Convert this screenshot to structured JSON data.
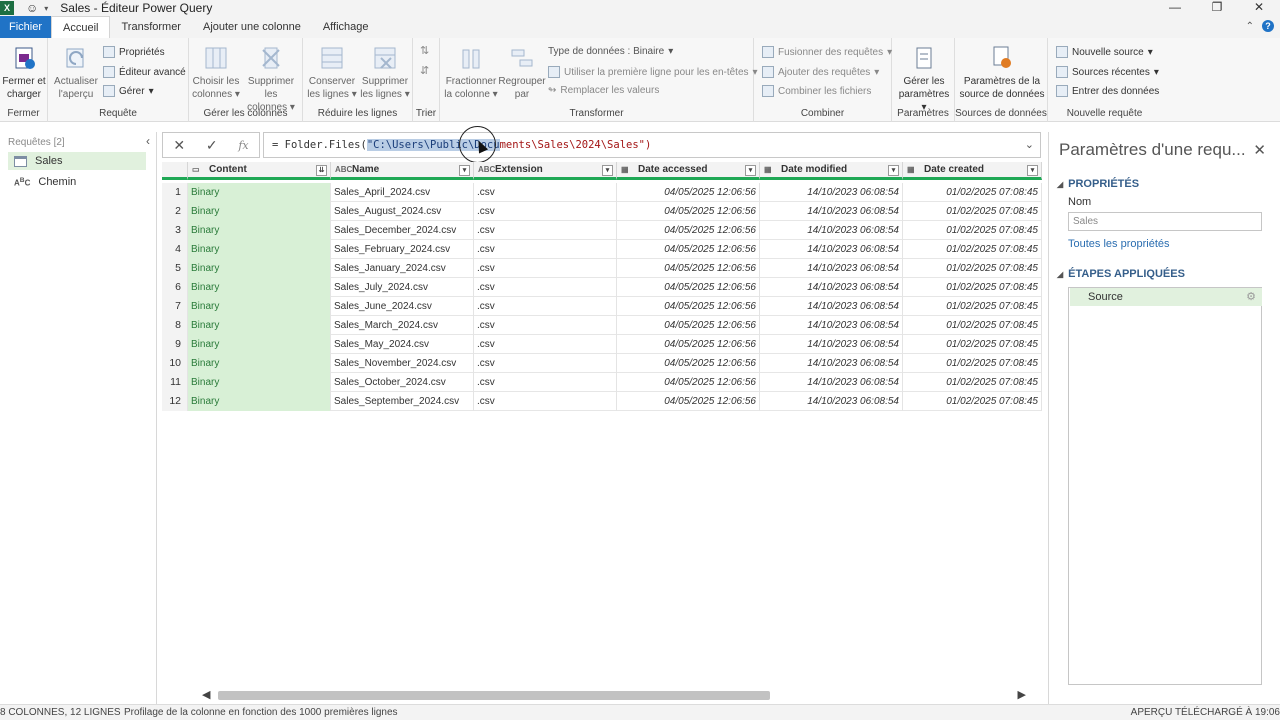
{
  "window": {
    "title": "Sales - Éditeur Power Query",
    "controls": {
      "minimize": "—",
      "restore": "❐",
      "close": "✕"
    }
  },
  "tabs": [
    {
      "label": "Fichier"
    },
    {
      "label": "Accueil"
    },
    {
      "label": "Transformer"
    },
    {
      "label": "Ajouter une colonne"
    },
    {
      "label": "Affichage"
    }
  ],
  "ribbon": {
    "fermer": {
      "btn": "Fermer et",
      "btn2": "charger",
      "group": "Fermer"
    },
    "requete": {
      "actualiser": "Actualiser",
      "actualiser2": "l'aperçu",
      "proprietes": "Propriétés",
      "editeur": "Éditeur avancé",
      "gerer": "Gérer",
      "group": "Requête"
    },
    "colonnes": {
      "choisir": "Choisir les",
      "choisir2": "colonnes",
      "supprimer": "Supprimer les",
      "supprimer2": "colonnes",
      "group": "Gérer les colonnes"
    },
    "lignes": {
      "conserver": "Conserver",
      "conserver2": "les lignes",
      "supprimer": "Supprimer",
      "supprimer2": "les lignes",
      "group": "Réduire les lignes"
    },
    "trier": {
      "group": "Trier"
    },
    "transformer": {
      "fractionner": "Fractionner",
      "fractionner2": "la colonne",
      "regrouper": "Regrouper",
      "regrouper2": "par",
      "type": "Type de données : Binaire",
      "premiere": "Utiliser la première ligne pour les en-têtes",
      "remplacer": "Remplacer les valeurs",
      "group": "Transformer"
    },
    "combiner": {
      "fusionner": "Fusionner des requêtes",
      "ajouter": "Ajouter des requêtes",
      "combiner": "Combiner les fichiers",
      "group": "Combiner"
    },
    "parametres": {
      "gerer": "Gérer les",
      "gerer2": "paramètres",
      "group": "Paramètres"
    },
    "sources": {
      "btn": "Paramètres de la",
      "btn2": "source de données",
      "group": "Sources de données"
    },
    "nouvelle": {
      "source": "Nouvelle source",
      "recentes": "Sources récentes",
      "entrer": "Entrer des données",
      "group": "Nouvelle requête"
    }
  },
  "formula": {
    "prefix": "= Folder.Files(",
    "selected": "\"C:\\Users\\Public\\Docu",
    "rest": "ments\\Sales\\2024\\Sales\")"
  },
  "queries": {
    "header": "Requêtes [2]",
    "items": [
      {
        "label": "Sales"
      },
      {
        "label": "Chemin"
      }
    ]
  },
  "grid": {
    "columns": [
      {
        "label": "Content",
        "type": "binary"
      },
      {
        "label": "Name",
        "type": "text"
      },
      {
        "label": "Extension",
        "type": "text"
      },
      {
        "label": "Date accessed",
        "type": "datetime"
      },
      {
        "label": "Date modified",
        "type": "datetime"
      },
      {
        "label": "Date created",
        "type": "datetime"
      }
    ],
    "rows": [
      {
        "n": "1",
        "content": "Binary",
        "name": "Sales_April_2024.csv",
        "ext": ".csv",
        "acc": "04/05/2025 12:06:56",
        "mod": "14/10/2023 06:08:54",
        "cre": "01/02/2025 07:08:45"
      },
      {
        "n": "2",
        "content": "Binary",
        "name": "Sales_August_2024.csv",
        "ext": ".csv",
        "acc": "04/05/2025 12:06:56",
        "mod": "14/10/2023 06:08:54",
        "cre": "01/02/2025 07:08:45"
      },
      {
        "n": "3",
        "content": "Binary",
        "name": "Sales_December_2024.csv",
        "ext": ".csv",
        "acc": "04/05/2025 12:06:56",
        "mod": "14/10/2023 06:08:54",
        "cre": "01/02/2025 07:08:45"
      },
      {
        "n": "4",
        "content": "Binary",
        "name": "Sales_February_2024.csv",
        "ext": ".csv",
        "acc": "04/05/2025 12:06:56",
        "mod": "14/10/2023 06:08:54",
        "cre": "01/02/2025 07:08:45"
      },
      {
        "n": "5",
        "content": "Binary",
        "name": "Sales_January_2024.csv",
        "ext": ".csv",
        "acc": "04/05/2025 12:06:56",
        "mod": "14/10/2023 06:08:54",
        "cre": "01/02/2025 07:08:45"
      },
      {
        "n": "6",
        "content": "Binary",
        "name": "Sales_July_2024.csv",
        "ext": ".csv",
        "acc": "04/05/2025 12:06:56",
        "mod": "14/10/2023 06:08:54",
        "cre": "01/02/2025 07:08:45"
      },
      {
        "n": "7",
        "content": "Binary",
        "name": "Sales_June_2024.csv",
        "ext": ".csv",
        "acc": "04/05/2025 12:06:56",
        "mod": "14/10/2023 06:08:54",
        "cre": "01/02/2025 07:08:45"
      },
      {
        "n": "8",
        "content": "Binary",
        "name": "Sales_March_2024.csv",
        "ext": ".csv",
        "acc": "04/05/2025 12:06:56",
        "mod": "14/10/2023 06:08:54",
        "cre": "01/02/2025 07:08:45"
      },
      {
        "n": "9",
        "content": "Binary",
        "name": "Sales_May_2024.csv",
        "ext": ".csv",
        "acc": "04/05/2025 12:06:56",
        "mod": "14/10/2023 06:08:54",
        "cre": "01/02/2025 07:08:45"
      },
      {
        "n": "10",
        "content": "Binary",
        "name": "Sales_November_2024.csv",
        "ext": ".csv",
        "acc": "04/05/2025 12:06:56",
        "mod": "14/10/2023 06:08:54",
        "cre": "01/02/2025 07:08:45"
      },
      {
        "n": "11",
        "content": "Binary",
        "name": "Sales_October_2024.csv",
        "ext": ".csv",
        "acc": "04/05/2025 12:06:56",
        "mod": "14/10/2023 06:08:54",
        "cre": "01/02/2025 07:08:45"
      },
      {
        "n": "12",
        "content": "Binary",
        "name": "Sales_September_2024.csv",
        "ext": ".csv",
        "acc": "04/05/2025 12:06:56",
        "mod": "14/10/2023 06:08:54",
        "cre": "01/02/2025 07:08:45"
      }
    ]
  },
  "settings": {
    "title": "Paramètres d'une requ...",
    "props_header": "PROPRIÉTÉS",
    "name_label": "Nom",
    "name_value": "Sales",
    "all_props": "Toutes les propriétés",
    "steps_header": "ÉTAPES APPLIQUÉES",
    "steps": [
      {
        "label": "Source"
      }
    ]
  },
  "status": {
    "cols_rows": "8 COLONNES, 12 LIGNES",
    "profiling": "Profilage de la colonne en fonction des 1000 premières lignes",
    "preview": "APERÇU TÉLÉCHARGÉ À 19:06"
  },
  "colors": {
    "accent": "#2073c6",
    "green": "#1fa855",
    "binary_bg": "#d8f0d6"
  }
}
